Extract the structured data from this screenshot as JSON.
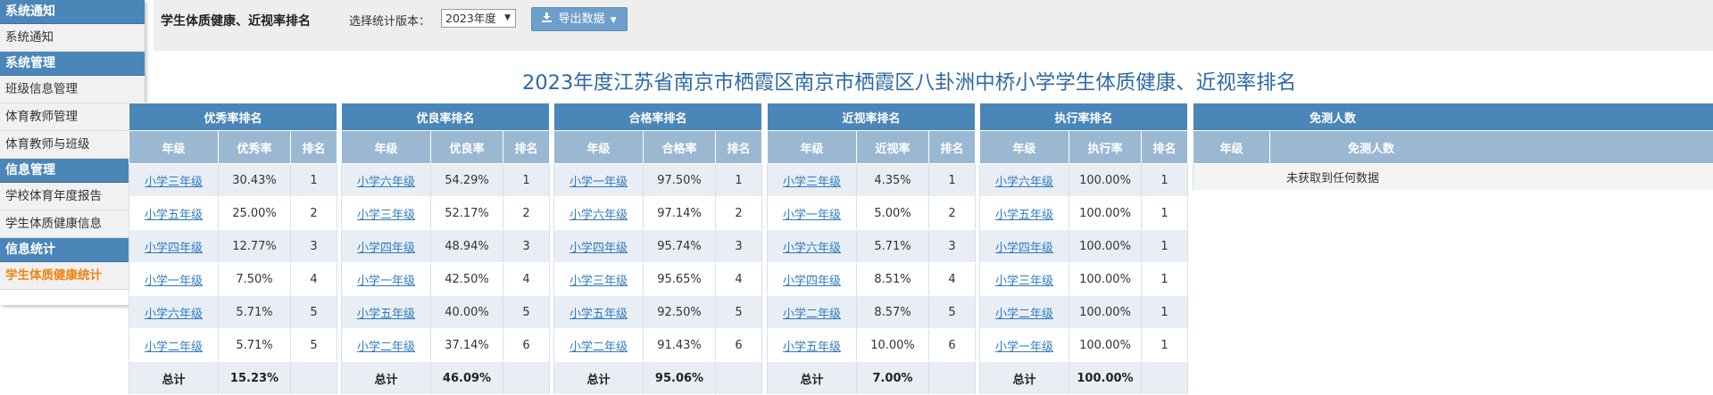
{
  "sidebar": {
    "sections": [
      {
        "header": "系统通知",
        "items": [
          {
            "label": "系统通知",
            "active": false
          }
        ]
      },
      {
        "header": "系统管理",
        "items": [
          {
            "label": "班级信息管理",
            "active": false
          },
          {
            "label": "体育教师管理",
            "active": false
          },
          {
            "label": "体育教师与班级",
            "active": false
          }
        ]
      },
      {
        "header": "信息管理",
        "items": [
          {
            "label": "学校体育年度报告",
            "active": false
          },
          {
            "label": "学生体质健康信息",
            "active": false
          }
        ]
      },
      {
        "header": "信息统计",
        "items": [
          {
            "label": "学生体质健康统计",
            "active": true
          }
        ]
      }
    ]
  },
  "toolbar": {
    "title": "学生体质健康、近视率排名",
    "version_label": "选择统计版本：",
    "version_value": "2023年度",
    "export_label": "导出数据"
  },
  "report_title": "2023年度江苏省南京市栖霞区南京市栖霞区八卦洲中桥小学学生体质健康、近视率排名",
  "tables": [
    {
      "title": "优秀率排名",
      "headers": [
        "年级",
        "优秀率",
        "排名"
      ],
      "rows": [
        [
          "小学三年级",
          "30.43%",
          "1"
        ],
        [
          "小学五年级",
          "25.00%",
          "2"
        ],
        [
          "小学四年级",
          "12.77%",
          "3"
        ],
        [
          "小学一年级",
          "7.50%",
          "4"
        ],
        [
          "小学六年级",
          "5.71%",
          "5"
        ],
        [
          "小学二年级",
          "5.71%",
          "5"
        ]
      ],
      "footer": [
        "总计",
        "15.23%",
        ""
      ]
    },
    {
      "title": "优良率排名",
      "headers": [
        "年级",
        "优良率",
        "排名"
      ],
      "rows": [
        [
          "小学六年级",
          "54.29%",
          "1"
        ],
        [
          "小学三年级",
          "52.17%",
          "2"
        ],
        [
          "小学四年级",
          "48.94%",
          "3"
        ],
        [
          "小学一年级",
          "42.50%",
          "4"
        ],
        [
          "小学五年级",
          "40.00%",
          "5"
        ],
        [
          "小学二年级",
          "37.14%",
          "6"
        ]
      ],
      "footer": [
        "总计",
        "46.09%",
        ""
      ]
    },
    {
      "title": "合格率排名",
      "headers": [
        "年级",
        "合格率",
        "排名"
      ],
      "rows": [
        [
          "小学一年级",
          "97.50%",
          "1"
        ],
        [
          "小学六年级",
          "97.14%",
          "2"
        ],
        [
          "小学四年级",
          "95.74%",
          "3"
        ],
        [
          "小学三年级",
          "95.65%",
          "4"
        ],
        [
          "小学五年级",
          "92.50%",
          "5"
        ],
        [
          "小学二年级",
          "91.43%",
          "6"
        ]
      ],
      "footer": [
        "总计",
        "95.06%",
        ""
      ]
    },
    {
      "title": "近视率排名",
      "headers": [
        "年级",
        "近视率",
        "排名"
      ],
      "rows": [
        [
          "小学三年级",
          "4.35%",
          "1"
        ],
        [
          "小学一年级",
          "5.00%",
          "2"
        ],
        [
          "小学六年级",
          "5.71%",
          "3"
        ],
        [
          "小学四年级",
          "8.51%",
          "4"
        ],
        [
          "小学二年级",
          "8.57%",
          "5"
        ],
        [
          "小学五年级",
          "10.00%",
          "6"
        ]
      ],
      "footer": [
        "总计",
        "7.00%",
        ""
      ]
    },
    {
      "title": "执行率排名",
      "headers": [
        "年级",
        "执行率",
        "排名"
      ],
      "rows": [
        [
          "小学六年级",
          "100.00%",
          "1"
        ],
        [
          "小学五年级",
          "100.00%",
          "1"
        ],
        [
          "小学四年级",
          "100.00%",
          "1"
        ],
        [
          "小学三年级",
          "100.00%",
          "1"
        ],
        [
          "小学二年级",
          "100.00%",
          "1"
        ],
        [
          "小学一年级",
          "100.00%",
          "1"
        ]
      ],
      "footer": [
        "总计",
        "100.00%",
        ""
      ]
    }
  ],
  "exempt_table": {
    "title": "免测人数",
    "headers": [
      "年级",
      "免测人数"
    ],
    "empty_text": "未获取到任何数据"
  },
  "icons": {
    "export": "download-icon",
    "caret": "caret-down-icon"
  },
  "colors": {
    "header_blue": "#4a86b8",
    "subheader_blue": "#9ab8d2",
    "title_blue": "#2d6aa6",
    "active_orange": "#f0820f",
    "link_blue": "#2f7bc0"
  }
}
